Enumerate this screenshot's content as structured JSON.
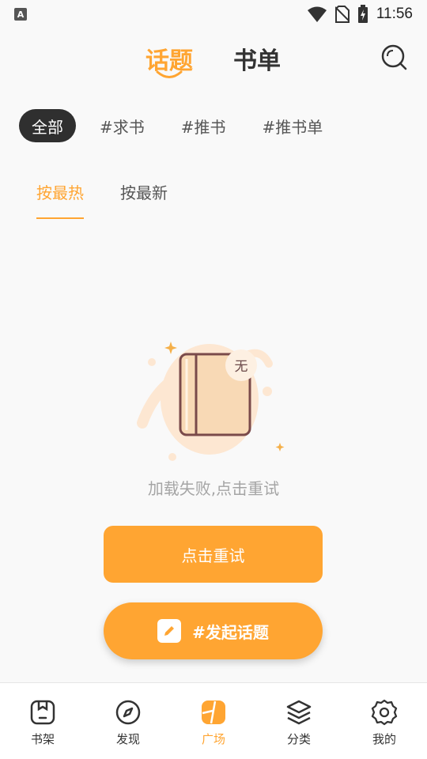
{
  "status_bar": {
    "app_icon_letter": "A",
    "time": "11:56",
    "icons": [
      "wifi-icon",
      "no-sim-icon",
      "battery-charging-icon"
    ]
  },
  "header": {
    "tabs": [
      {
        "label": "话题",
        "active": true
      },
      {
        "label": "书单",
        "active": false
      }
    ],
    "search_icon": "search-icon"
  },
  "filter_chips": [
    {
      "label": "全部",
      "active": true
    },
    {
      "label": "#求书",
      "active": false
    },
    {
      "label": "#推书",
      "active": false
    },
    {
      "label": "#推书单",
      "active": false
    }
  ],
  "sort_tabs": [
    {
      "label": "按最热",
      "active": true
    },
    {
      "label": "按最新",
      "active": false
    }
  ],
  "empty_state": {
    "badge": "无",
    "message": "加载失败,点击重试",
    "retry_label": "点击重试"
  },
  "start_topic": {
    "label": "#发起话题",
    "icon": "pencil-icon"
  },
  "bottom_nav": [
    {
      "label": "书架",
      "icon": "bookshelf-icon",
      "active": false
    },
    {
      "label": "发现",
      "icon": "compass-icon",
      "active": false
    },
    {
      "label": "广场",
      "icon": "square-icon",
      "active": true
    },
    {
      "label": "分类",
      "icon": "layers-icon",
      "active": false
    },
    {
      "label": "我的",
      "icon": "gear-icon",
      "active": false
    }
  ],
  "colors": {
    "accent": "#ffa532",
    "chip_active_bg": "#2f2f2f",
    "background": "#f9f9f9"
  }
}
